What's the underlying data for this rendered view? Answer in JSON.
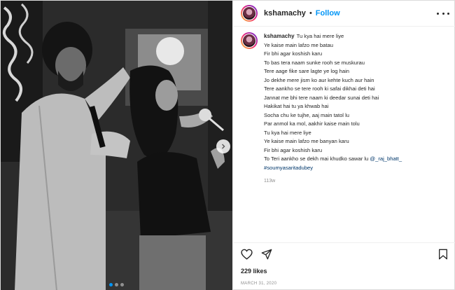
{
  "header": {
    "username": "kshamachy",
    "separator": "•",
    "follow_label": "Follow"
  },
  "caption": {
    "username": "kshamachy",
    "lines": [
      "Tu kya hai mere liye",
      "Ye kaise main lafzo me batau",
      "Fir bhi agar koshish karu",
      "To bas tera naam sunke rooh se muskurau",
      "Tere aage fike sare lagte ye log hain",
      "Jo dekhe mere jism ko aur kehte kuch aur hain",
      "Tere aankho se tere rooh ki safai dikhai deti hai",
      "Jannat me bhi tere naam ki deedar sunai deti hai",
      "Hakikat hai tu ya khwab hai",
      "Socha chu ke tujhe, aaj main tatol lu",
      "Par anmol ka mol, aakhir kaise main tolu",
      "Tu kya hai mere liye",
      "Ye kaise main lafzo me banyan karu",
      "Fir bhi agar koshish karu",
      "To Teri aankho se dekh mai khudko sawar lu"
    ],
    "mention": "@_raj_bhatt_",
    "hashtag": "#soumyasaritadubey",
    "time_ago": "113w"
  },
  "actions": {
    "like_icon": "heart-icon",
    "share_icon": "paper-plane-icon",
    "save_icon": "bookmark-icon"
  },
  "likes_text": "229 likes",
  "date_text": "MARCH 31, 2020",
  "carousel": {
    "total": 3,
    "active": 1,
    "active_color": "#0095f6"
  }
}
